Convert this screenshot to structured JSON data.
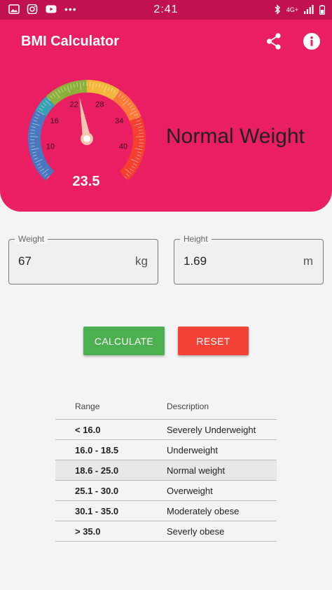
{
  "status_bar": {
    "time": "2:41",
    "left_icons": [
      "gallery-icon",
      "instagram-icon",
      "youtube-icon",
      "more-dots-icon"
    ],
    "right_icons": [
      "bluetooth-icon",
      "network-4g-icon",
      "signal-icon",
      "battery-icon"
    ],
    "network_label": "4G+"
  },
  "app_bar": {
    "title": "BMI Calculator",
    "actions": [
      "share-icon",
      "info-icon"
    ]
  },
  "gauge": {
    "min": 5,
    "max": 45,
    "value": 23.5,
    "value_label": "23.5",
    "ticks": [
      {
        "label": "10",
        "value": 10
      },
      {
        "label": "16",
        "value": 16
      },
      {
        "label": "22",
        "value": 22
      },
      {
        "label": "28",
        "value": 28
      },
      {
        "label": "34",
        "value": 34
      },
      {
        "label": "40",
        "value": 40
      }
    ],
    "ranges": [
      {
        "from": 5,
        "to": 16,
        "color": "#4a78c0"
      },
      {
        "from": 16,
        "to": 18.5,
        "color": "#37a0b3"
      },
      {
        "from": 18.5,
        "to": 25,
        "color": "#8cb13b"
      },
      {
        "from": 25,
        "to": 30,
        "color": "#f1b63a"
      },
      {
        "from": 30,
        "to": 35,
        "color": "#fb7a3a"
      },
      {
        "from": 35,
        "to": 45,
        "color": "#f3402f"
      }
    ],
    "category": "Normal Weight"
  },
  "inputs": {
    "weight": {
      "label": "Weight",
      "value": "67",
      "unit": "kg"
    },
    "height": {
      "label": "Height",
      "value": "1.69",
      "unit": "m"
    }
  },
  "buttons": {
    "calculate": "CALCULATE",
    "reset": "RESET"
  },
  "table": {
    "headers": [
      "Range",
      "Description"
    ],
    "rows": [
      {
        "range": "< 16.0",
        "description": "Severely Underweight"
      },
      {
        "range": "16.0 - 18.5",
        "description": "Underweight"
      },
      {
        "range": "18.6 - 25.0",
        "description": "Normal weight",
        "highlighted": true
      },
      {
        "range": "25.1 - 30.0",
        "description": "Overweight"
      },
      {
        "range": "30.1 - 35.0",
        "description": "Moderately obese"
      },
      {
        "range": "> 35.0",
        "description": "Severly obese"
      }
    ]
  },
  "colors": {
    "status_bar": "#c2114f",
    "header": "#e91e63",
    "calculate": "#4caf50",
    "reset": "#f44336",
    "needle": "#f7c6b0"
  }
}
